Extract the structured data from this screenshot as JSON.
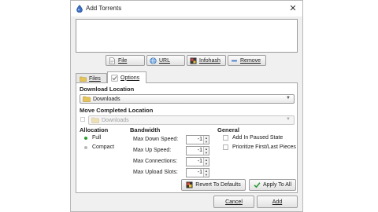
{
  "window": {
    "title": "Add Torrents",
    "close_glyph": "✕"
  },
  "toolbar": {
    "file_label": "File",
    "url_label": "URL",
    "infohash_label": "Infohash",
    "remove_label": "Remove"
  },
  "tabs": {
    "files": "Files",
    "options": "Options"
  },
  "options": {
    "download_location_heading": "Download Location",
    "download_location_value": "Downloads",
    "move_completed_heading": "Move Completed Location",
    "move_completed_value": "Downloads",
    "allocation_heading": "Allocation",
    "allocation_full": "Full",
    "allocation_compact": "Compact",
    "bandwidth_heading": "Bandwidth",
    "max_down_speed_label": "Max Down Speed:",
    "max_down_speed_value": "-1",
    "max_up_speed_label": "Max Up Speed:",
    "max_up_speed_value": "-1",
    "max_connections_label": "Max Connections:",
    "max_connections_value": "-1",
    "max_upload_slots_label": "Max Upload Slots:",
    "max_upload_slots_value": "-1",
    "general_heading": "General",
    "add_paused_label": "Add In Paused State",
    "prioritize_label": "Prioritize First/Last Pieces",
    "revert_button": "Revert To Defaults",
    "apply_button": "Apply To All"
  },
  "footer": {
    "cancel_label": "Cancel",
    "add_label": "Add"
  },
  "colors": {
    "accent_green": "#2e9b33",
    "folder": "#e7c45a",
    "disabled_text": "#a0a0a0"
  }
}
